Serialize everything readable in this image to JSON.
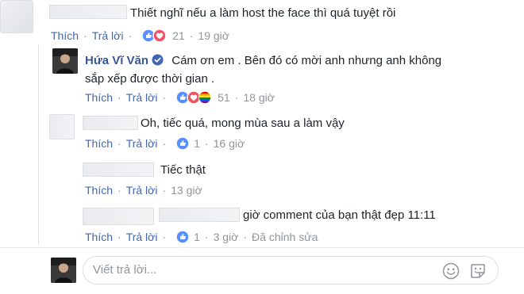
{
  "comments": [
    {
      "text": "Thiết nghĩ nếu a làm host the face thì quá tuyệt rồi",
      "like_label": "Thích",
      "reply_label": "Trả lời",
      "reaction_count": "21",
      "time": "19 giờ",
      "reactions": [
        "like",
        "love"
      ]
    },
    {
      "author": "Hứa Vĩ Văn",
      "verified": true,
      "text_line1": "Cám ơn em . Bên đó có mời anh nhưng anh không",
      "text_line2": "sắp xếp được thời gian .",
      "like_label": "Thích",
      "reply_label": "Trả lời",
      "reaction_count": "51",
      "time": "18 giờ",
      "reactions": [
        "like",
        "love",
        "pride"
      ]
    },
    {
      "text": "Oh, tiếc quá, mong mùa sau a làm vậy",
      "like_label": "Thích",
      "reply_label": "Trả lời",
      "reaction_count": "1",
      "time": "16 giờ",
      "reactions": [
        "like"
      ]
    },
    {
      "text": "Tiếc thật",
      "like_label": "Thích",
      "reply_label": "Trả lời",
      "time": "13 giờ"
    },
    {
      "text": "giờ comment của bạn thật đẹp 11:11",
      "like_label": "Thích",
      "reply_label": "Trả lời",
      "reaction_count": "1",
      "time": "3 giờ",
      "edited": "Đã chỉnh sửa",
      "reactions": [
        "like"
      ]
    }
  ],
  "reply_box": {
    "placeholder": "Viết trả lời..."
  },
  "colors": {
    "link": "#4267b2",
    "name": "#365899",
    "meta": "#90949c",
    "like_blue": "#5890ff",
    "love_red": "#f25268"
  },
  "icons": [
    "like-icon",
    "love-icon",
    "pride-icon",
    "verified-badge-icon",
    "emoji-icon",
    "sticker-icon"
  ]
}
